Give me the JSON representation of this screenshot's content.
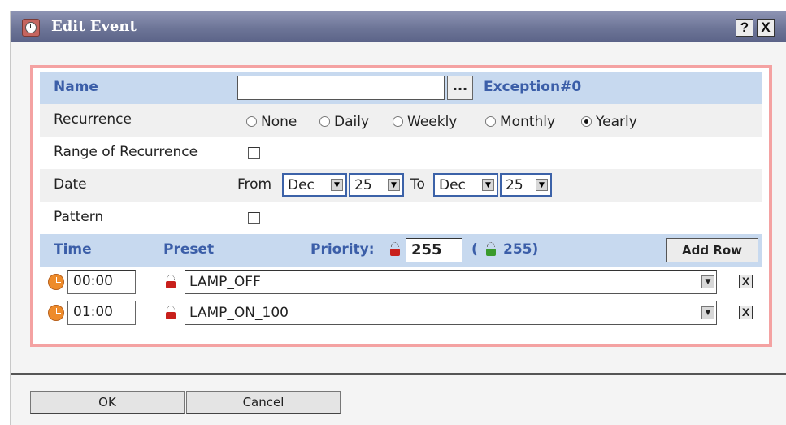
{
  "window": {
    "title": "Edit Event",
    "help_label": "?",
    "close_label": "X"
  },
  "name_row": {
    "label": "Name",
    "value": "",
    "browse_label": "...",
    "exception_label": "Exception#0"
  },
  "recurrence": {
    "label": "Recurrence",
    "options": [
      {
        "label": "None",
        "selected": false
      },
      {
        "label": "Daily",
        "selected": false
      },
      {
        "label": "Weekly",
        "selected": false
      },
      {
        "label": "Monthly",
        "selected": false
      },
      {
        "label": "Yearly",
        "selected": true
      }
    ]
  },
  "range": {
    "label": "Range of Recurrence",
    "checked": false
  },
  "date": {
    "label": "Date",
    "from_label": "From",
    "to_label": "To",
    "from_month": "Dec",
    "from_day": "25",
    "to_month": "Dec",
    "to_day": "25"
  },
  "pattern": {
    "label": "Pattern",
    "checked": false
  },
  "schedule_header": {
    "time_label": "Time",
    "preset_label": "Preset",
    "priority_label": "Priority:",
    "priority_value": "255",
    "paren_open": "(",
    "paren_value": "255)",
    "add_row_label": "Add Row"
  },
  "schedule_rows": [
    {
      "time": "00:00",
      "preset": "LAMP_OFF",
      "delete_label": "X"
    },
    {
      "time": "01:00",
      "preset": "LAMP_ON_100",
      "delete_label": "X"
    }
  ],
  "footer": {
    "ok_label": "OK",
    "cancel_label": "Cancel"
  },
  "colors": {
    "accent_border": "#f4a2a2",
    "header_bg": "#c7d9ef",
    "header_text": "#3b5ea8",
    "title_bar": "#6d7597"
  }
}
